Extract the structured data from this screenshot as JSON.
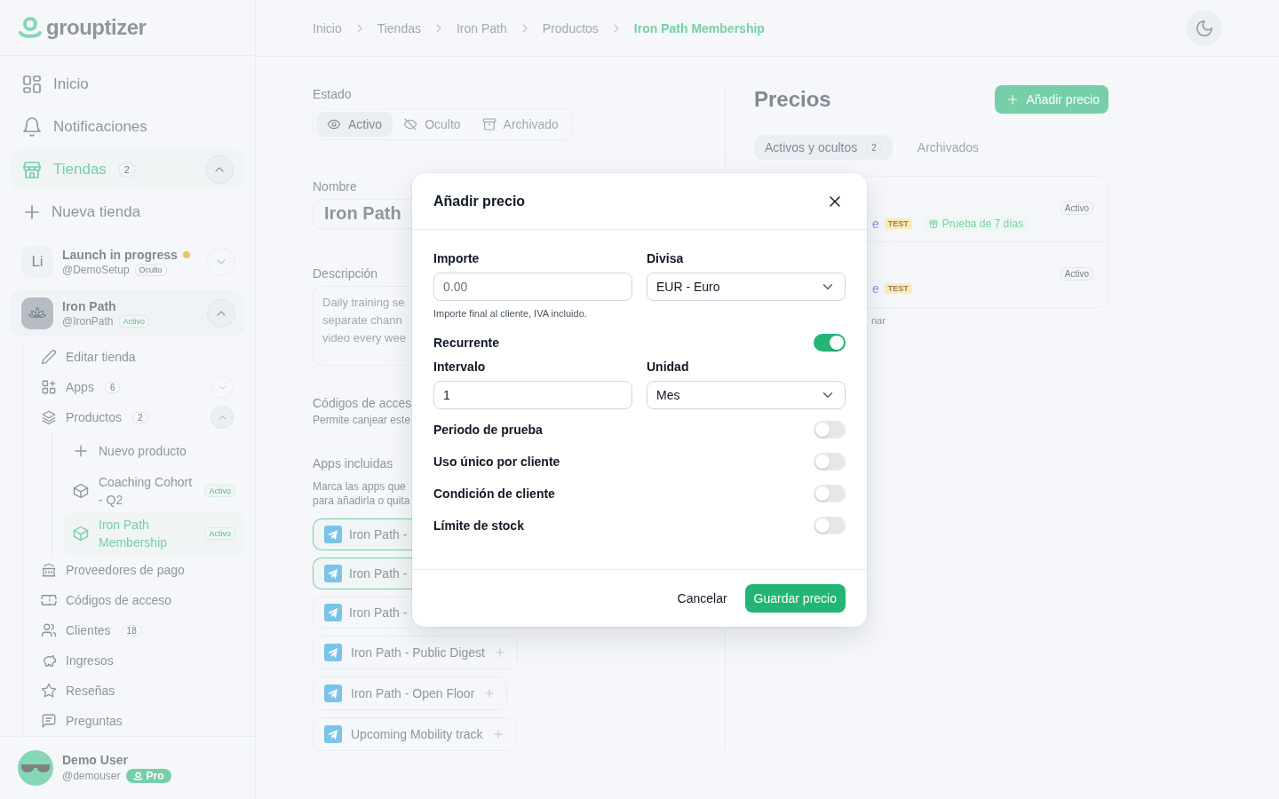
{
  "brand": {
    "name": "grouptizer"
  },
  "sidebar": {
    "items": [
      {
        "label": "Inicio",
        "selected": false
      },
      {
        "label": "Notificaciones",
        "selected": false
      },
      {
        "label": "Tiendas",
        "badge": "2",
        "selected": true,
        "expanded": true
      }
    ],
    "new_store": {
      "label": "Nueva tienda"
    },
    "stores": [
      {
        "avatar": "Li",
        "name": "Launch in progress",
        "dot": true,
        "handle": "@DemoSetup",
        "status": "Oculto",
        "active": false,
        "expanded": false
      },
      {
        "name": "Iron Path",
        "dot": false,
        "handle": "@IronPath",
        "status": "Activo",
        "active": true,
        "expanded": true,
        "children": [
          {
            "label": "Editar tienda"
          },
          {
            "label": "Apps",
            "badge": "6",
            "expanded": false
          },
          {
            "label": "Productos",
            "badge": "2",
            "expanded": true,
            "children": [
              {
                "kind": "add",
                "label": "Nuevo producto"
              },
              {
                "kind": "product",
                "label": "Coaching Cohort - Q2",
                "status": "Activo",
                "selected": false
              },
              {
                "kind": "product",
                "label": "Iron Path Membership",
                "status": "Activo",
                "selected": true
              }
            ]
          },
          {
            "label": "Proveedores de pago"
          },
          {
            "label": "Códigos de acceso"
          },
          {
            "label": "Clientes",
            "badge": "18"
          },
          {
            "label": "Ingresos"
          },
          {
            "label": "Reseñas"
          },
          {
            "label": "Preguntas"
          }
        ]
      }
    ],
    "user": {
      "name": "Demo User",
      "handle": "@demouser",
      "plan": "Pro"
    }
  },
  "breadcrumb": [
    {
      "label": "Inicio",
      "current": false
    },
    {
      "label": "Tiendas",
      "current": false
    },
    {
      "label": "Iron Path",
      "current": false
    },
    {
      "label": "Productos",
      "current": false
    },
    {
      "label": "Iron Path Membership",
      "current": true
    }
  ],
  "product": {
    "status": {
      "label": "Estado",
      "options": [
        {
          "label": "Activo",
          "selected": true
        },
        {
          "label": "Oculto",
          "selected": false
        },
        {
          "label": "Archivado",
          "selected": false
        }
      ]
    },
    "name": {
      "label": "Nombre",
      "value": "Iron Path"
    },
    "description": {
      "label": "Descripción",
      "lines": [
        "Daily training se",
        "separate chann",
        "video every wee"
      ]
    },
    "codes": {
      "label": "Códigos de acces",
      "hint": "Permite canjear este"
    },
    "apps": {
      "label": "Apps incluidas",
      "hint_lines": [
        "Marca las apps que",
        "para añadirla o quita"
      ],
      "items": [
        {
          "label": "Iron Path -",
          "selected": true,
          "cut": true
        },
        {
          "label": "Iron Path -",
          "selected": true,
          "cut": true
        },
        {
          "label": "Iron Path -",
          "selected": false,
          "cut": true
        },
        {
          "label": "Iron Path - Public Digest",
          "selected": false,
          "cut": false
        },
        {
          "label": "Iron Path - Open Floor",
          "selected": false,
          "cut": false
        },
        {
          "label": "Upcoming Mobility track",
          "selected": false,
          "cut": false
        }
      ]
    }
  },
  "prices": {
    "title": "Precios",
    "add_button": "Añadir precio",
    "tabs": [
      {
        "label": "Activos y ocultos",
        "badge": "2",
        "selected": true
      },
      {
        "label": "Archivados",
        "selected": false
      }
    ],
    "rows": [
      {
        "name_tail": "e",
        "tag": "TEST",
        "trial": "Prueba de 7 días",
        "status": "Activo"
      },
      {
        "name_tail": "e",
        "tag": "TEST",
        "status": "Activo"
      }
    ],
    "footer_tail": "nar"
  },
  "modal": {
    "title": "Añadir precio",
    "amount": {
      "label": "Importe",
      "placeholder": "0.00",
      "help": "Importe final al cliente, IVA incluido."
    },
    "currency": {
      "label": "Divisa",
      "value": "EUR - Euro"
    },
    "recurring": {
      "label": "Recurrente",
      "on": true
    },
    "interval": {
      "label": "Intervalo",
      "value": "1"
    },
    "unit": {
      "label": "Unidad",
      "value": "Mes"
    },
    "toggles": [
      {
        "label": "Periodo de prueba",
        "on": false
      },
      {
        "label": "Uso único por cliente",
        "on": false
      },
      {
        "label": "Condición de cliente",
        "on": false
      },
      {
        "label": "Límite de stock",
        "on": false
      }
    ],
    "cancel": "Cancelar",
    "save": "Guardar precio"
  }
}
